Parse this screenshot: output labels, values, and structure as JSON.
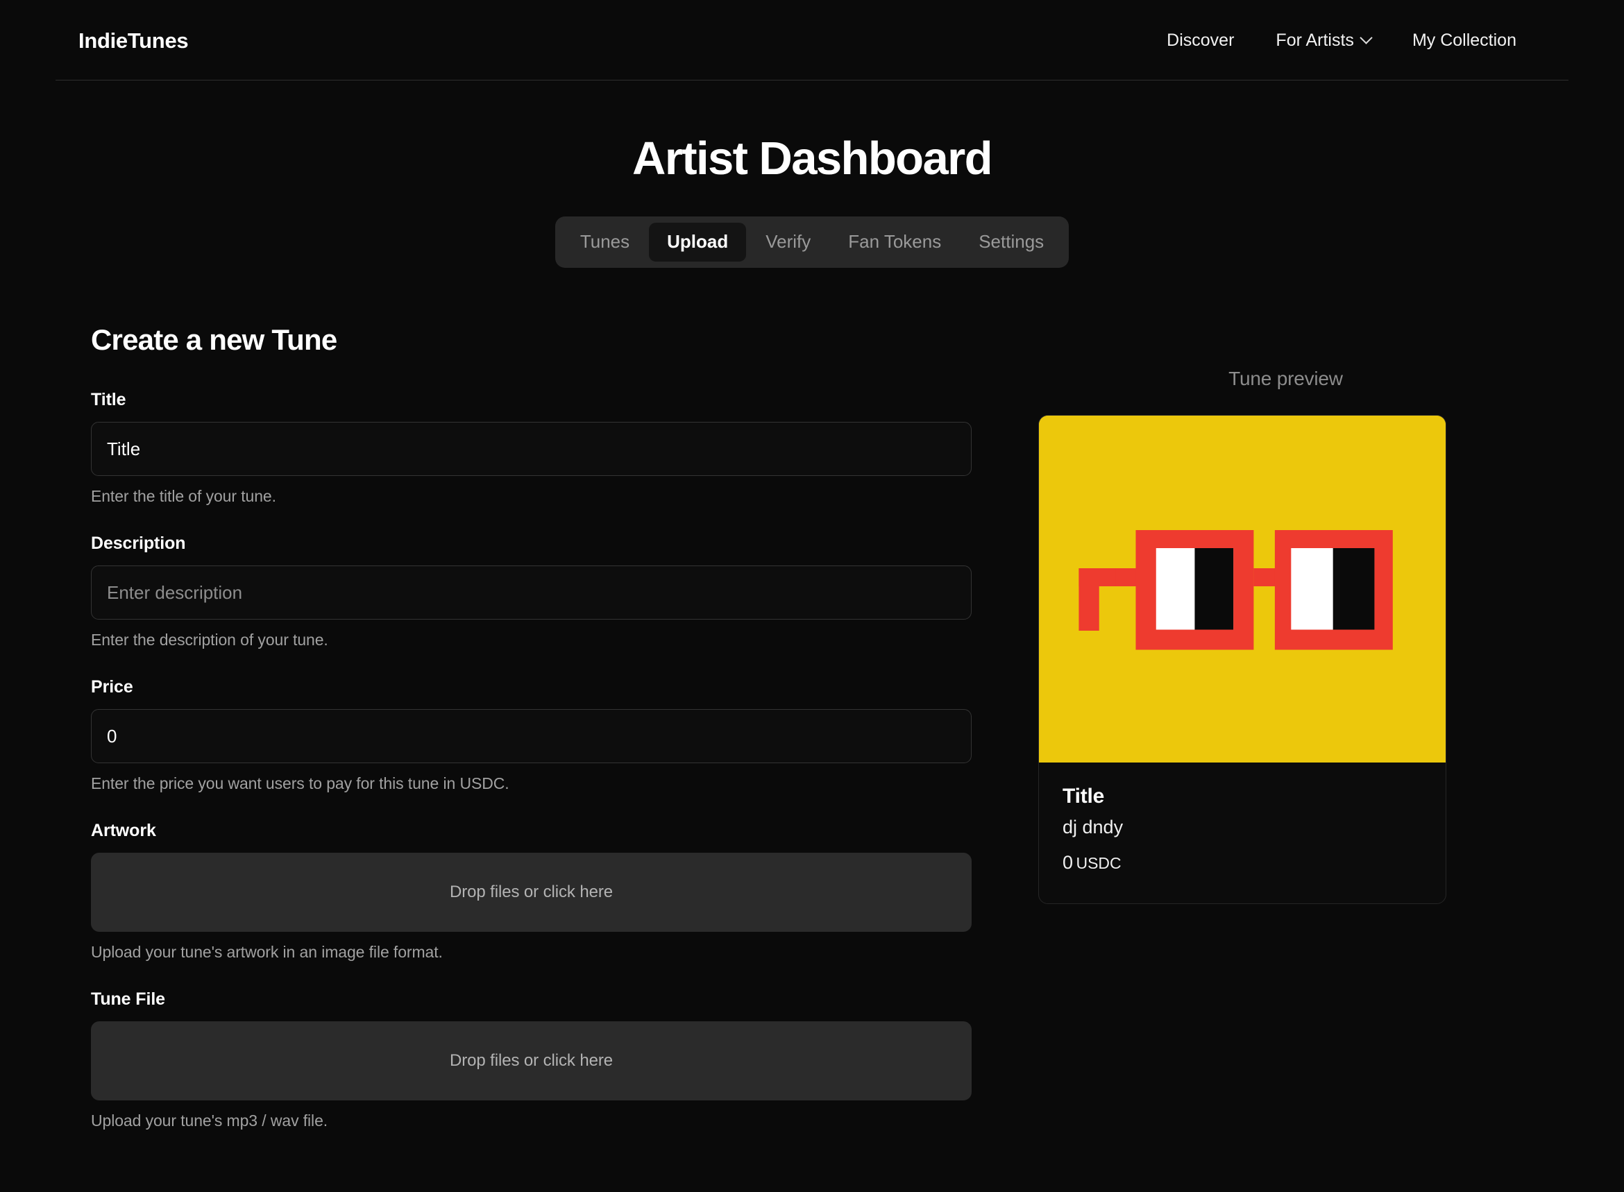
{
  "header": {
    "brand": "IndieTunes",
    "nav": [
      {
        "label": "Discover",
        "has_chevron": false
      },
      {
        "label": "For Artists",
        "has_chevron": true
      },
      {
        "label": "My Collection",
        "has_chevron": false
      }
    ]
  },
  "page": {
    "title": "Artist Dashboard"
  },
  "tabs": {
    "items": [
      {
        "label": "Tunes",
        "active": false
      },
      {
        "label": "Upload",
        "active": true
      },
      {
        "label": "Verify",
        "active": false
      },
      {
        "label": "Fan Tokens",
        "active": false
      },
      {
        "label": "Settings",
        "active": false
      }
    ]
  },
  "form": {
    "heading": "Create a new Tune",
    "title_field": {
      "label": "Title",
      "value": "Title",
      "placeholder": "Title",
      "help": "Enter the title of your tune."
    },
    "description_field": {
      "label": "Description",
      "value": "",
      "placeholder": "Enter description",
      "help": "Enter the description of your tune."
    },
    "price_field": {
      "label": "Price",
      "value": "0",
      "placeholder": "0",
      "help": "Enter the price you want users to pay for this tune in USDC."
    },
    "artwork_field": {
      "label": "Artwork",
      "dropzone_text": "Drop files or click here",
      "help": "Upload your tune's artwork in an image file format."
    },
    "tune_file_field": {
      "label": "Tune File",
      "dropzone_text": "Drop files or click here",
      "help": "Upload your tune's mp3 / wav file."
    }
  },
  "preview": {
    "heading": "Tune preview",
    "card": {
      "title": "Title",
      "artist": "dj dndy",
      "price_amount": "0",
      "price_currency": "USDC",
      "artwork": {
        "name": "pixel-sunglasses-artwork",
        "background_color": "#ECC80C",
        "frame_color": "#EE3B2F",
        "lens_light_color": "#FFFFFF",
        "lens_dark_color": "#0A0A0A"
      }
    }
  },
  "colors": {
    "page_background": "#0A0A0A",
    "tab_bar_background": "#282828",
    "tab_active_background": "#141414",
    "input_background": "#0D0D0D",
    "input_border": "#343434",
    "dropzone_background": "#2B2B2B",
    "muted_text": "#A1A1A1"
  }
}
